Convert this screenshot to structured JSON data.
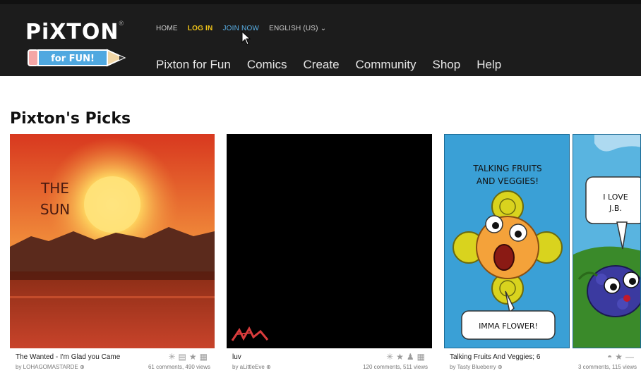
{
  "header": {
    "logo_text": "PiXTON",
    "logo_reg": "®",
    "tagline": "for FUN!",
    "util_nav": {
      "home": "HOME",
      "login": "LOG IN",
      "join": "JOIN NOW",
      "language": "ENGLISH (US)"
    },
    "main_nav": [
      "Pixton for Fun",
      "Comics",
      "Create",
      "Community",
      "Shop",
      "Help"
    ]
  },
  "section": {
    "title": "Pixton's Picks"
  },
  "comics": [
    {
      "title": "The Wanted - I'm Glad you Came",
      "by": "by LOHAGOMASTARDE ⊕",
      "stats": "61 comments, 490 views",
      "art_text": [
        "THE",
        "SUN"
      ]
    },
    {
      "title": "luv",
      "by": "by aLittleEve ⊕",
      "stats": "120 comments, 511 views",
      "art_text": []
    },
    {
      "title": "Talking Fruits And Veggies; 6",
      "by": "by Tasty Blueberry ⊕",
      "stats": "3 comments, 115 views",
      "art_text": [
        "TALKING FRUITS",
        "AND VEGGIES!",
        "IMMA FLOWER!",
        "I LOVE",
        "J.B."
      ]
    }
  ],
  "colors": {
    "header_bg": "#1c1c1c",
    "login": "#f0c419",
    "join": "#5ab0e6",
    "panel_blue": "#3aa0d6"
  }
}
